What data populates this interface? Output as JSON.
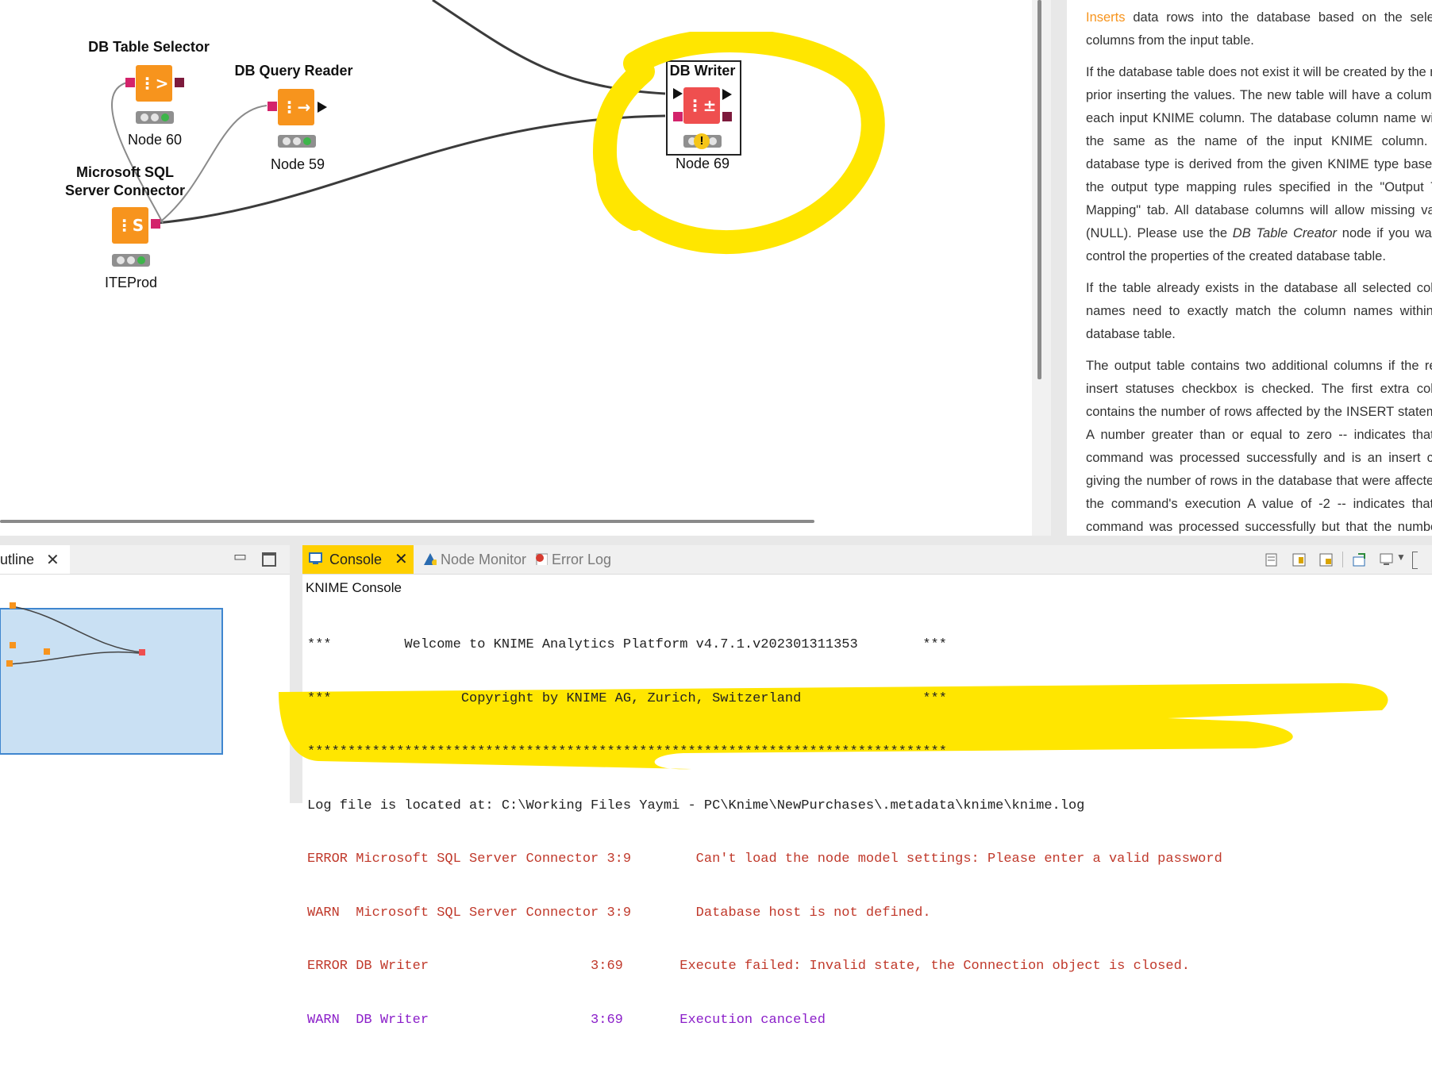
{
  "workflow": {
    "nodes": [
      {
        "id": "db-table-selector",
        "title": "DB Table Selector",
        "label": "Node 60"
      },
      {
        "id": "db-query-reader",
        "title": "DB Query Reader",
        "label": "Node 59"
      },
      {
        "id": "ms-sql-connector",
        "title_line1": "Microsoft SQL",
        "title_line2": "Server Connector",
        "label": "ITEProd"
      },
      {
        "id": "db-writer",
        "title": "DB Writer",
        "label": "Node 69"
      }
    ],
    "highlight_color": "#ffe600"
  },
  "description": {
    "p1_link": "Inserts",
    "p1_rest": " data rows into the database based on the selected columns from the input table.",
    "p2_a": "If the database table does not exist it will be created by the node prior inserting the values. The new table will have a column for each input KNIME column. The database column name will be the same as the name of the input KNIME column. The database type is derived from the given KNIME type based on the output type mapping rules specified in the \"Output Type Mapping\" tab. All database columns will allow missing values (NULL). Please use the ",
    "p2_italic": "DB Table Creator",
    "p2_b": " node if you want to control the properties of the created database table.",
    "p3": "If the table already exists in the database all selected column names need to exactly match the column names within the database table.",
    "p4": "The output table contains two additional columns if the report insert statuses checkbox is checked. The first extra column contains the number of rows affected by the INSERT statement. A number greater than or equal to zero -- indicates that the command was processed successfully and is an insert count giving the number of rows in the database that were affected by the command's execution A value of -2 -- indicates that the command was processed successfully but that the number of rows affected is unknown"
  },
  "outline": {
    "tab_label": "utline"
  },
  "console": {
    "tabs": [
      {
        "label": "Console",
        "active": true
      },
      {
        "label": "Node Monitor",
        "active": false
      },
      {
        "label": "Error Log",
        "active": false
      }
    ],
    "title": "KNIME Console",
    "lines": [
      {
        "level": "info",
        "text": "***         Welcome to KNIME Analytics Platform v4.7.1.v202301311353        ***"
      },
      {
        "level": "info",
        "text": "***                Copyright by KNIME AG, Zurich, Switzerland               ***"
      },
      {
        "level": "info",
        "text": "*******************************************************************************"
      },
      {
        "level": "info",
        "text": "Log file is located at: C:\\Working Files Yaymi - PC\\Knime\\NewPurchases\\.metadata\\knime\\knime.log"
      },
      {
        "level": "error",
        "text": "ERROR Microsoft SQL Server Connector 3:9        Can't load the node model settings: Please enter a valid password"
      },
      {
        "level": "warn",
        "text": "WARN  Microsoft SQL Server Connector 3:9        Database host is not defined."
      },
      {
        "level": "error",
        "text": "ERROR DB Writer                    3:69       Execute failed: Invalid state, the Connection object is closed."
      },
      {
        "level": "warn2",
        "text": "WARN  DB Writer                    3:69       Execution canceled"
      }
    ]
  },
  "colors": {
    "node_orange": "#f7941d",
    "node_writer": "#ef4f4f",
    "console_tab_active": "#ffd000",
    "error_text": "#c0392b",
    "warn_text": "#8b1fc9"
  }
}
